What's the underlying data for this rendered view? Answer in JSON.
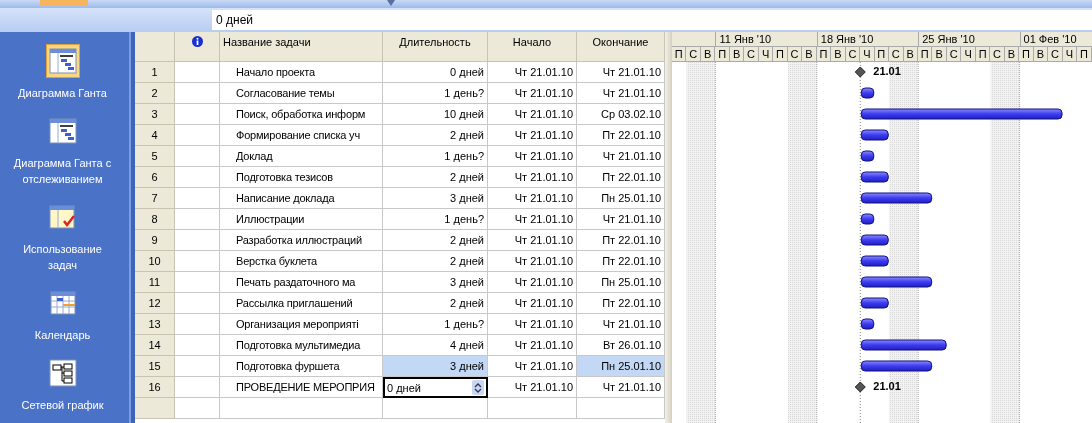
{
  "entry_bar": {
    "value": "0 дней"
  },
  "sidebar": {
    "items": [
      {
        "label": "Диаграмма Ганта",
        "kind": "gantt",
        "selected": true
      },
      {
        "label": "Диаграмма Ганта с отслеживанием",
        "kind": "tracking",
        "selected": false
      },
      {
        "label": "Использование задач",
        "kind": "usage",
        "selected": false
      },
      {
        "label": "Календарь",
        "kind": "calendar",
        "selected": false
      },
      {
        "label": "Сетевой график",
        "kind": "network",
        "selected": false
      }
    ]
  },
  "table": {
    "columns": [
      "Название задачи",
      "Длительность",
      "Начало",
      "Окончание"
    ],
    "rows": [
      {
        "id": "1",
        "name": "Начало проекта",
        "duration": "0 дней",
        "start": "Чт 21.01.10",
        "finish": "Чт 21.01.10",
        "kind": "milestone",
        "milestone_label": "21.01",
        "selected": false,
        "editing": false
      },
      {
        "id": "2",
        "name": "Согласование темы",
        "duration": "1 день?",
        "start": "Чт 21.01.10",
        "finish": "Чт 21.01.10",
        "kind": "task",
        "selected": false,
        "editing": false
      },
      {
        "id": "3",
        "name": "Поиск, обработка информ",
        "duration": "10 дней",
        "start": "Чт 21.01.10",
        "finish": "Ср 03.02.10",
        "kind": "task",
        "selected": false,
        "editing": false
      },
      {
        "id": "4",
        "name": "Формирование списка уч",
        "duration": "2 дней",
        "start": "Чт 21.01.10",
        "finish": "Пт 22.01.10",
        "kind": "task",
        "selected": false,
        "editing": false
      },
      {
        "id": "5",
        "name": "Доклад",
        "duration": "1 день?",
        "start": "Чт 21.01.10",
        "finish": "Чт 21.01.10",
        "kind": "task",
        "selected": false,
        "editing": false
      },
      {
        "id": "6",
        "name": "Подготовка тезисов",
        "duration": "2 дней",
        "start": "Чт 21.01.10",
        "finish": "Пт 22.01.10",
        "kind": "task",
        "selected": false,
        "editing": false
      },
      {
        "id": "7",
        "name": "Написание доклада",
        "duration": "3 дней",
        "start": "Чт 21.01.10",
        "finish": "Пн 25.01.10",
        "kind": "task",
        "selected": false,
        "editing": false
      },
      {
        "id": "8",
        "name": "Иллюстрации",
        "duration": "1 день?",
        "start": "Чт 21.01.10",
        "finish": "Чт 21.01.10",
        "kind": "task",
        "selected": false,
        "editing": false
      },
      {
        "id": "9",
        "name": "Разработка иллюстраций",
        "duration": "2 дней",
        "start": "Чт 21.01.10",
        "finish": "Пт 22.01.10",
        "kind": "task",
        "selected": false,
        "editing": false
      },
      {
        "id": "10",
        "name": "Верстка буклета",
        "duration": "2 дней",
        "start": "Чт 21.01.10",
        "finish": "Пт 22.01.10",
        "kind": "task",
        "selected": false,
        "editing": false
      },
      {
        "id": "11",
        "name": "Печать раздаточного ма",
        "duration": "3 дней",
        "start": "Чт 21.01.10",
        "finish": "Пн 25.01.10",
        "kind": "task",
        "selected": false,
        "editing": false
      },
      {
        "id": "12",
        "name": "Рассылка приглашений",
        "duration": "2 дней",
        "start": "Чт 21.01.10",
        "finish": "Пт 22.01.10",
        "kind": "task",
        "selected": false,
        "editing": false
      },
      {
        "id": "13",
        "name": "Организация мероприяті",
        "duration": "1 день?",
        "start": "Чт 21.01.10",
        "finish": "Чт 21.01.10",
        "kind": "task",
        "selected": false,
        "editing": false
      },
      {
        "id": "14",
        "name": "Подготовка мультимедиа",
        "duration": "4 дней",
        "start": "Чт 21.01.10",
        "finish": "Вт 26.01.10",
        "kind": "task",
        "selected": false,
        "editing": false
      },
      {
        "id": "15",
        "name": "Подготовка фуршета",
        "duration": "3 дней",
        "start": "Чт 21.01.10",
        "finish": "Пн 25.01.10",
        "kind": "task",
        "selected": true,
        "editing": false
      },
      {
        "id": "16",
        "name": "ПРОВЕДЕНИЕ МЕРОПРИЯ",
        "duration": "0 дней",
        "start": "Чт 21.01.10",
        "finish": "Чт 21.01.10",
        "kind": "milestone",
        "milestone_label": "21.01",
        "selected": false,
        "editing": true
      }
    ]
  },
  "gantt": {
    "day_letters": [
      "П",
      "С",
      "В",
      "П",
      "В",
      "С",
      "Ч",
      "П",
      "С",
      "В",
      "П",
      "В",
      "С",
      "Ч",
      "П",
      "С",
      "В",
      "П",
      "В",
      "С",
      "Ч",
      "П",
      "С",
      "В",
      "П",
      "В",
      "С",
      "Ч",
      "П"
    ],
    "weeks": [
      "11 Янв '10",
      "18 Янв '10",
      "25 Янв '10",
      "01 Фев '10"
    ]
  }
}
